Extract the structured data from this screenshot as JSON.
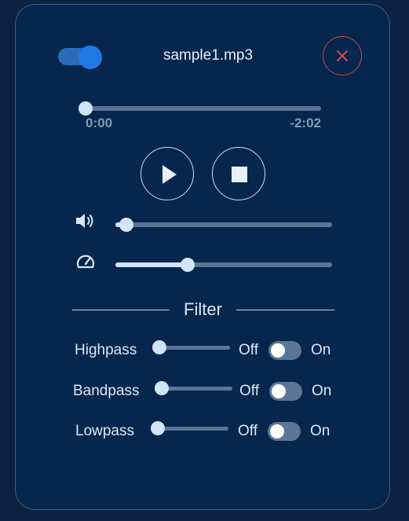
{
  "player": {
    "file_name": "sample1.mp3",
    "enabled": true,
    "current_time": "0:00",
    "remaining_time": "-2:02",
    "seek_progress": 0,
    "volume_level": 0.05,
    "speed_level": 0.33
  },
  "filter": {
    "title": "Filter",
    "rows": [
      {
        "label": "Highpass",
        "off_label": "Off",
        "on_label": "On",
        "enabled": false,
        "level": 0
      },
      {
        "label": "Bandpass",
        "off_label": "Off",
        "on_label": "On",
        "enabled": false,
        "level": 0
      },
      {
        "label": "Lowpass",
        "off_label": "Off",
        "on_label": "On",
        "enabled": false,
        "level": 0
      }
    ]
  },
  "icons": {
    "close": "close-icon",
    "play": "play-icon",
    "stop": "stop-icon",
    "volume": "volume-icon",
    "speed": "speedometer-icon"
  },
  "colors": {
    "background": "#0b2240",
    "panel": "#06264d",
    "accent": "#1f7ae6",
    "close": "#c9474f"
  }
}
